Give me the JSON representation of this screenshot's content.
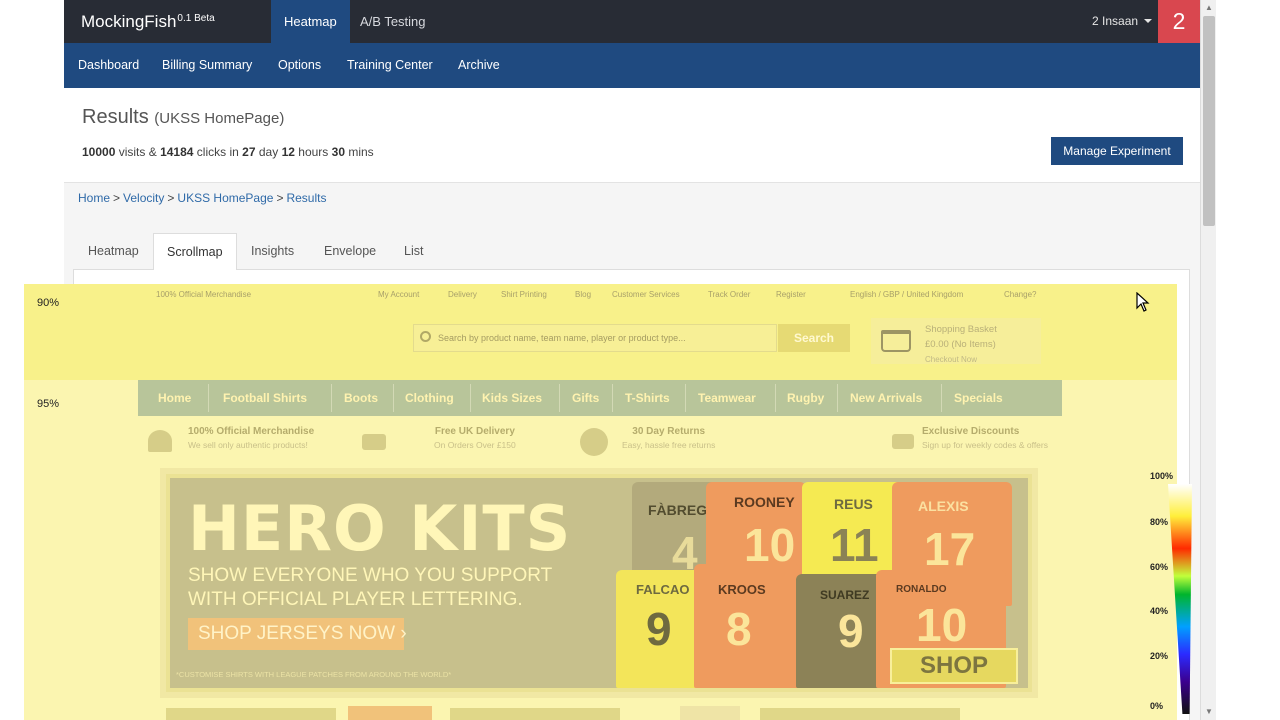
{
  "app": {
    "brand": "MockingFish",
    "brand_version": "0.1 Beta",
    "top_tabs": [
      {
        "label": "Heatmap",
        "active": true
      },
      {
        "label": "A/B Testing",
        "active": false
      }
    ],
    "user_name": "2 Insaan",
    "notification_count": "2"
  },
  "subnav": {
    "items": [
      "Dashboard",
      "Billing Summary",
      "Options",
      "Training Center",
      "Archive"
    ]
  },
  "results": {
    "title": "Results",
    "page_name": "(UKSS HomePage)",
    "visits": "10000",
    "visits_label": "visits &",
    "clicks": "14184",
    "clicks_label": "clicks in",
    "days": "27",
    "days_label": "day",
    "hours": "12",
    "hours_label": "hours",
    "mins": "30",
    "mins_label": "mins",
    "manage_button": "Manage Experiment"
  },
  "breadcrumb": {
    "items": [
      "Home",
      "Velocity",
      "UKSS HomePage",
      "Results"
    ],
    "separator": ">"
  },
  "tabs": [
    {
      "label": "Heatmap",
      "active": false
    },
    {
      "label": "Scrollmap",
      "active": true
    },
    {
      "label": "Insights",
      "active": false
    },
    {
      "label": "Envelope",
      "active": false
    },
    {
      "label": "List",
      "active": false
    }
  ],
  "scrollmap": {
    "bands": [
      {
        "label": "90%",
        "color": "#f8f18a"
      },
      {
        "label": "95%",
        "color": "#fbf5b0"
      }
    ],
    "legend": [
      "100%",
      "80%",
      "60%",
      "40%",
      "20%",
      "0%"
    ]
  },
  "site_preview": {
    "top_strip": [
      "100% Official Merchandise",
      "My Account",
      "Delivery",
      "Shirt Printing",
      "Blog",
      "Customer Services",
      "Track Order",
      "Register",
      "English / GBP / United Kingdom",
      "Change?"
    ],
    "search_placeholder": "Search by product name, team name, player or product type...",
    "search_button": "Search",
    "basket_title": "Shopping Basket",
    "basket_amount": "£0.00 (No Items)",
    "basket_checkout": "Checkout Now",
    "nav": [
      "Home",
      "Football Shirts",
      "Boots",
      "Clothing",
      "Kids Sizes",
      "Gifts",
      "T-Shirts",
      "Teamwear",
      "Rugby",
      "New Arrivals",
      "Specials"
    ],
    "usps": [
      {
        "title": "100% Official Merchandise",
        "sub": "We sell only authentic products!"
      },
      {
        "title": "Free UK Delivery",
        "sub": "On Orders Over £150"
      },
      {
        "title": "30 Day Returns",
        "sub": "Easy, hassle free returns"
      },
      {
        "title": "Exclusive Discounts",
        "sub": "Sign up for weekly codes & offers"
      }
    ],
    "hero": {
      "title": "HERO KITS",
      "sub_line1": "SHOW EVERYONE WHO YOU SUPPORT",
      "sub_line2": "WITH OFFICIAL PLAYER LETTERING.",
      "cta": "SHOP JERSEYS NOW",
      "footnote": "*CUSTOMISE SHIRTS WITH LEAGUE PATCHES FROM AROUND THE WORLD*",
      "shop_now": "SHOP NOW",
      "jerseys": [
        {
          "name": "FÀBREGAS",
          "number": "4"
        },
        {
          "name": "ROONEY",
          "number": "10"
        },
        {
          "name": "REUS",
          "number": "11"
        },
        {
          "name": "ALEXIS",
          "number": "17"
        },
        {
          "name": "FALCAO",
          "number": "9"
        },
        {
          "name": "KROOS",
          "number": "8"
        },
        {
          "name": "SUAREZ",
          "number": "9"
        },
        {
          "name": "RONALDO",
          "number": "10"
        }
      ]
    }
  }
}
